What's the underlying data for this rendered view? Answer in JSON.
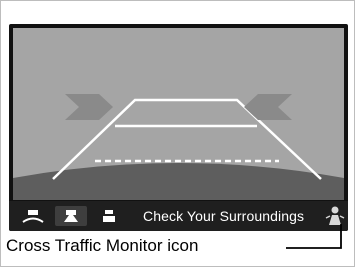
{
  "status_bar": {
    "message": "Check Your Surroundings",
    "view_buttons": [
      {
        "name": "wide-view-icon",
        "active": false
      },
      {
        "name": "normal-view-icon",
        "active": true
      },
      {
        "name": "top-down-view-icon",
        "active": false
      }
    ],
    "cross_traffic_icon": "cross-traffic-monitor-icon"
  },
  "caption": {
    "label": "Cross Traffic Monitor icon"
  },
  "colors": {
    "sky": "#a5a5a5",
    "ground": "#5e5e5e",
    "guide_lines": "#ffffff",
    "arrows": "#8a8a8a",
    "status_bar": "#1f1f1f",
    "text": "#ffffff"
  }
}
